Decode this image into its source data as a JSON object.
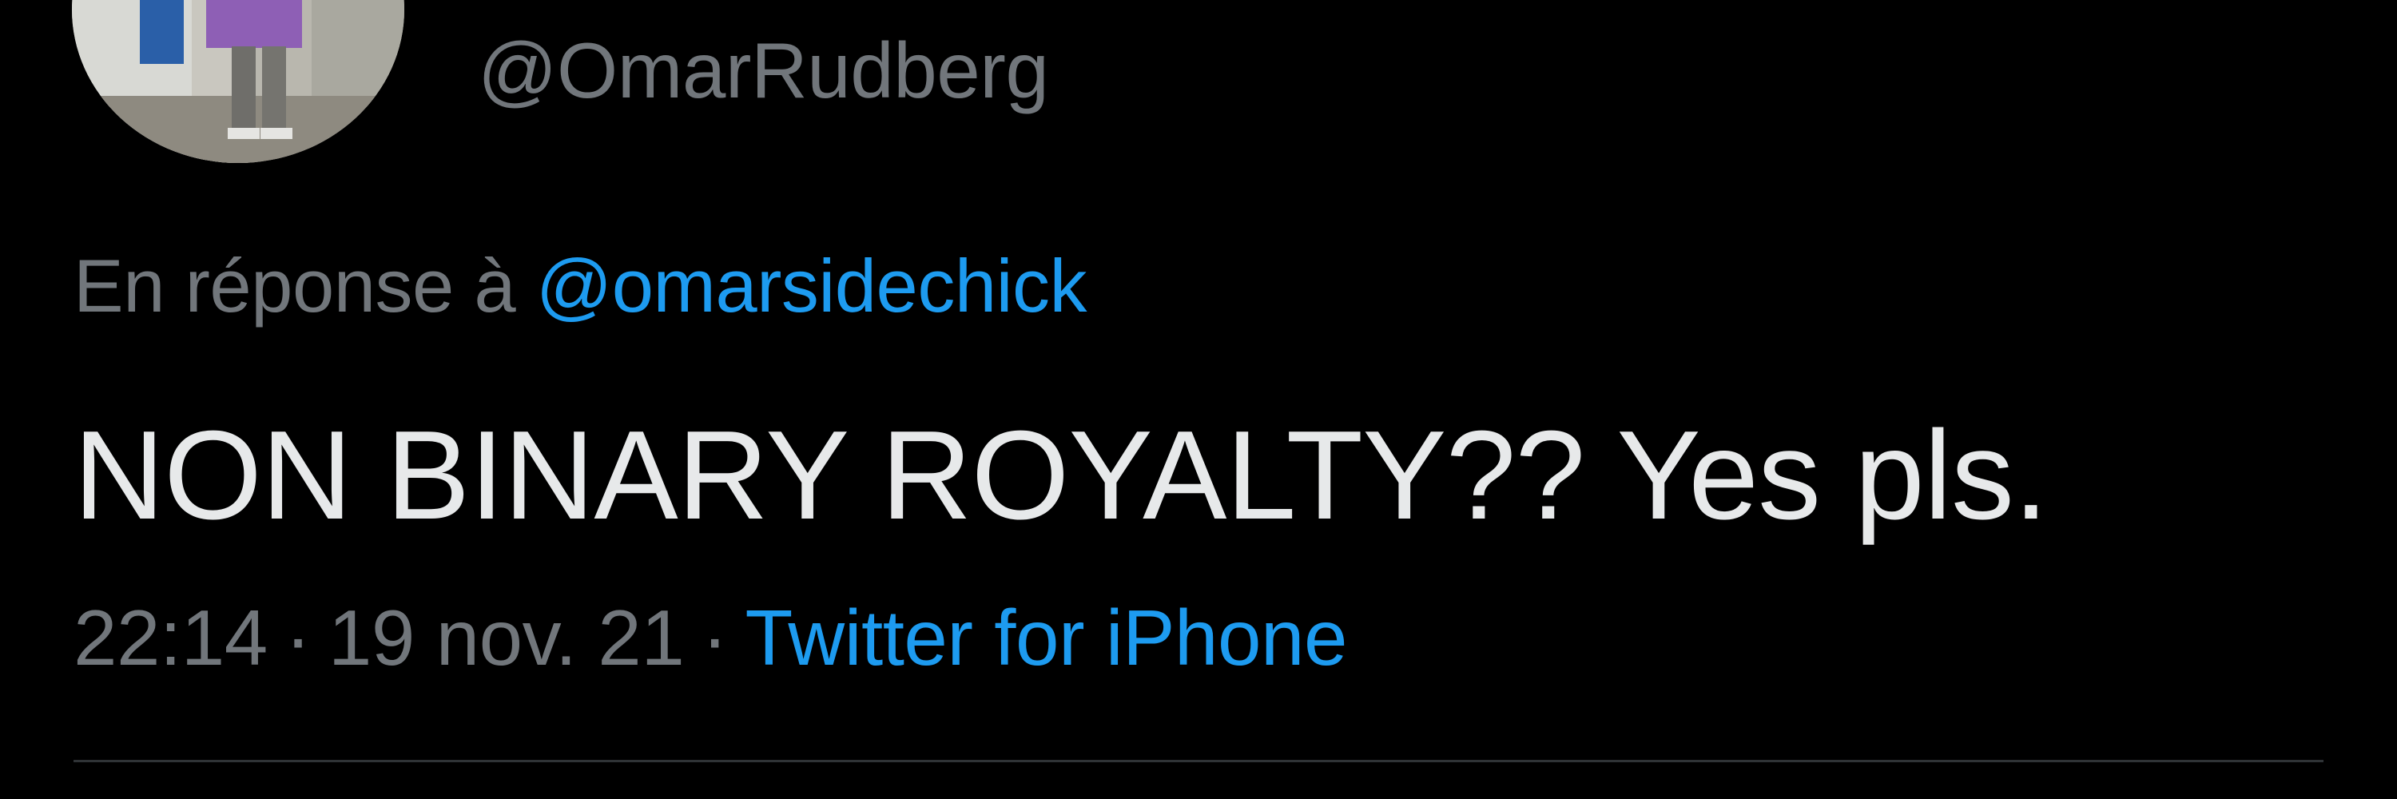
{
  "tweet": {
    "author_handle": "@OmarRudberg",
    "reply_prefix": "En réponse à",
    "reply_to": "@omarsidechick",
    "text": "NON BINARY ROYALTY?? Yes pls.",
    "time": "22:14",
    "date": "19 nov. 21",
    "separator": "·",
    "source": "Twitter for iPhone"
  },
  "colors": {
    "background": "#000000",
    "primary_text": "#e7e9ea",
    "secondary_text": "#71767b",
    "link": "#1d9bf0",
    "divider": "#2f3336"
  }
}
